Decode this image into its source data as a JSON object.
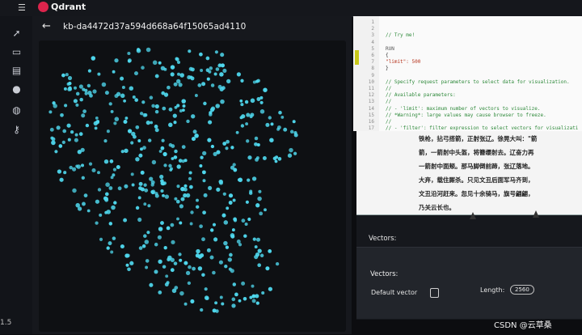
{
  "header": {
    "menu_icon": "hamburger-icon",
    "brand": "Qdrant"
  },
  "sidebar": {
    "items": [
      {
        "icon": "rocket-icon"
      },
      {
        "icon": "console-icon"
      },
      {
        "icon": "collections-icon"
      },
      {
        "icon": "lightbulb-icon"
      },
      {
        "icon": "datasets-icon"
      },
      {
        "icon": "key-icon"
      }
    ],
    "footer_text": "1.5"
  },
  "collection": {
    "back_icon": "back-arrow-icon",
    "title": "kb-da4472d37a594d668a64f15065ad4110"
  },
  "editor": {
    "lines": [
      {
        "n": "1",
        "text": ""
      },
      {
        "n": "2",
        "text": ""
      },
      {
        "n": "3",
        "text": "// Try me!"
      },
      {
        "n": "4",
        "text": ""
      },
      {
        "n": "5",
        "text": "RUN"
      },
      {
        "n": "6",
        "text": "{"
      },
      {
        "n": "7",
        "text": "\"limit\": 500"
      },
      {
        "n": "8",
        "text": "}"
      },
      {
        "n": "9",
        "text": ""
      },
      {
        "n": "10",
        "text": "// Specify request parameters to select data for visualization."
      },
      {
        "n": "11",
        "text": "//"
      },
      {
        "n": "12",
        "text": "// Available parameters:"
      },
      {
        "n": "13",
        "text": "//"
      },
      {
        "n": "14",
        "text": "// - 'limit': maximum number of vectors to visualize."
      },
      {
        "n": "15",
        "text": "//          *Warning*: large values may cause browser to freeze."
      },
      {
        "n": "16",
        "text": "//"
      },
      {
        "n": "17",
        "text": "// - 'filter': filter expression to select vectors for visualizati"
      }
    ]
  },
  "point_card": {
    "lines": [
      "铁枪，拈弓搭箭，正射张辽。徐晃大叫：\"箭",
      "箭，一箭射中头盔，将簪缨射去。辽奋力再",
      "一箭射中面颊。那马脚倒前蹄，张辽落地。",
      "大弃，载住厮杀。只见文丑后面军马齐到，",
      "文丑沿河赶来。忽见十余骑马，旗号翩翩，",
      "乃关云长也。"
    ]
  },
  "vectors": {
    "heading": "Vectors:",
    "details_heading": "Vectors:",
    "default_vector_label": "Default vector",
    "copy_icon": "copy-icon",
    "length_label": "Length:",
    "length_value": "2560"
  },
  "watermark": "CSDN @云草桑",
  "colors": {
    "accent": "#dc244c",
    "point": "#4fd8ee",
    "editor_bg": "#fafafa",
    "app_bg": "#16181d"
  }
}
